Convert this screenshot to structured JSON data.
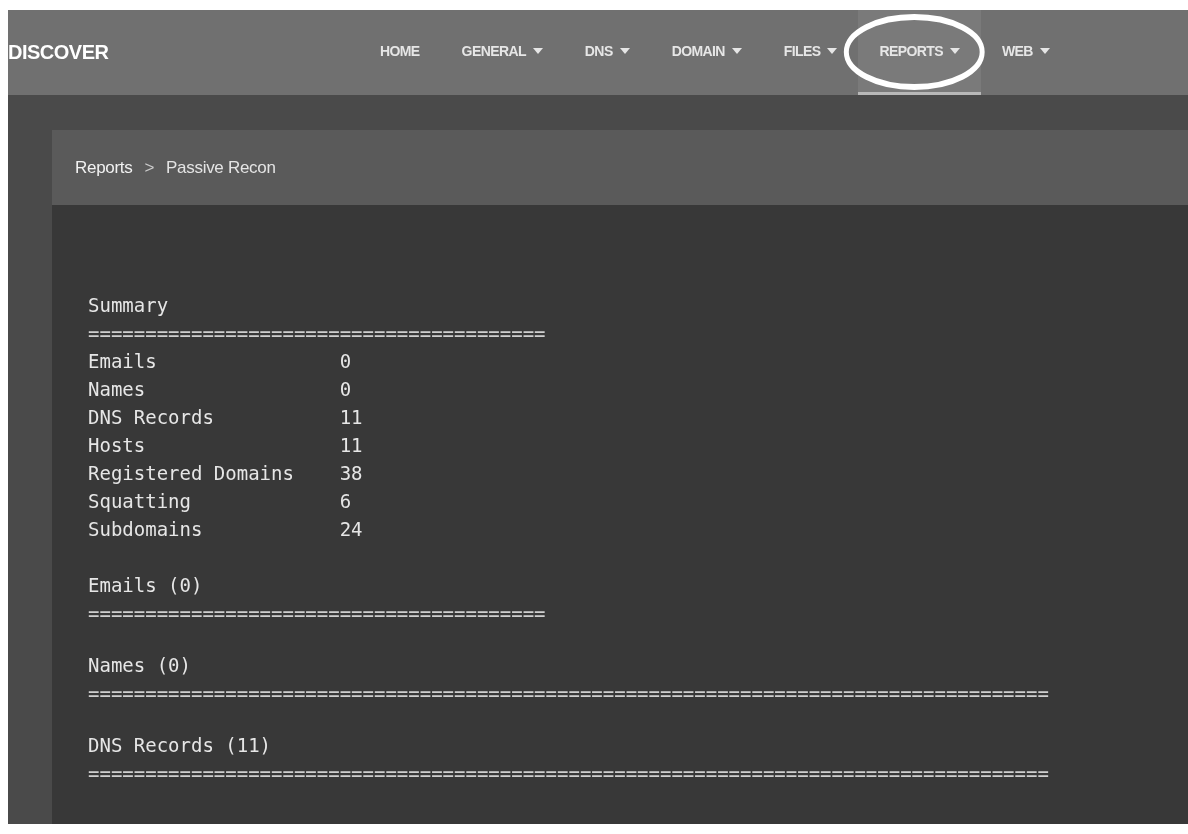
{
  "brand": "DISCOVER",
  "nav": [
    {
      "label": "HOME",
      "dropdown": false,
      "selected": false,
      "circled": false
    },
    {
      "label": "GENERAL",
      "dropdown": true,
      "selected": false,
      "circled": false
    },
    {
      "label": "DNS",
      "dropdown": true,
      "selected": false,
      "circled": false
    },
    {
      "label": "DOMAIN",
      "dropdown": true,
      "selected": false,
      "circled": false
    },
    {
      "label": "FILES",
      "dropdown": true,
      "selected": false,
      "circled": false
    },
    {
      "label": "REPORTS",
      "dropdown": true,
      "selected": true,
      "circled": true
    },
    {
      "label": "WEB",
      "dropdown": true,
      "selected": false,
      "circled": false
    }
  ],
  "breadcrumb": [
    {
      "kind": "link",
      "text": "Reports"
    },
    {
      "kind": "separator",
      "text": ">"
    },
    {
      "kind": "current",
      "text": "Passive Recon"
    }
  ],
  "report": {
    "sections": [
      {
        "title": "Summary",
        "rule": "========================================",
        "rows": [
          {
            "label": "Emails",
            "value": "0"
          },
          {
            "label": "Names",
            "value": "0"
          },
          {
            "label": "DNS Records",
            "value": "11"
          },
          {
            "label": "Hosts",
            "value": "11"
          },
          {
            "label": "Registered Domains",
            "value": "38"
          },
          {
            "label": "Squatting",
            "value": "6"
          },
          {
            "label": "Subdomains",
            "value": "24"
          }
        ]
      },
      {
        "title": "Emails (0)",
        "rule": "========================================"
      },
      {
        "title": "Names (0)",
        "rule": "===================================================================================="
      },
      {
        "title": "DNS Records (11)",
        "rule": "===================================================================================="
      }
    ]
  }
}
